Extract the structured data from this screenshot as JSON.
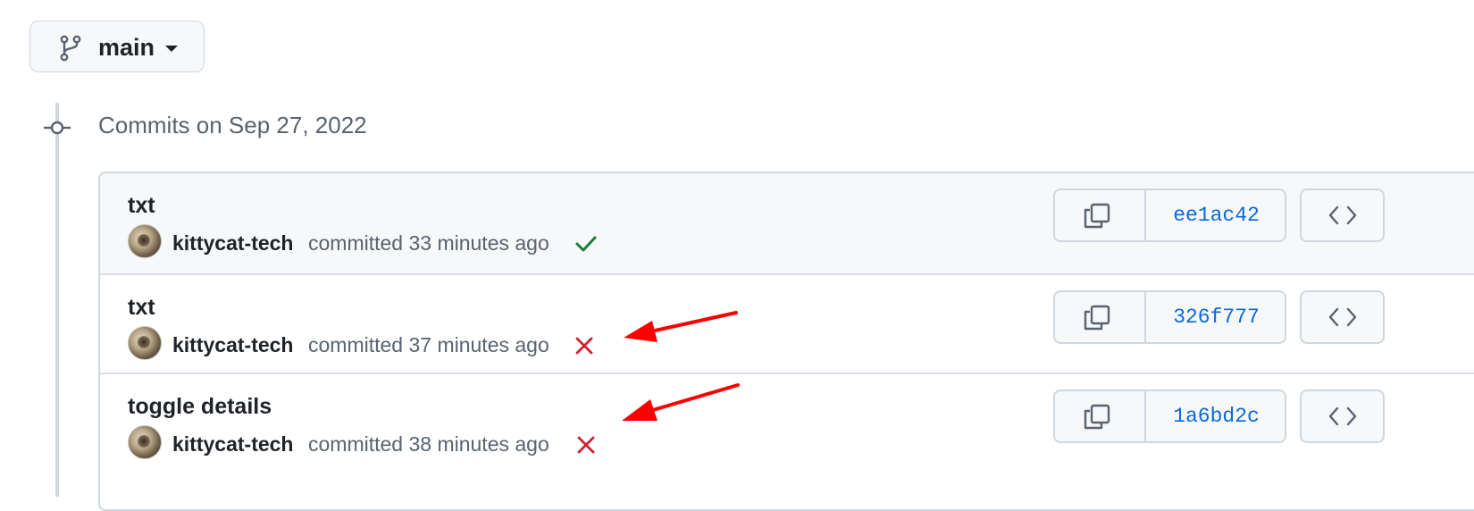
{
  "branch": {
    "name": "main",
    "icon": "git-branch-icon"
  },
  "date_heading": "Commits on Sep 27, 2022",
  "commits": [
    {
      "title": "txt",
      "author": "kittycat-tech",
      "meta": "committed 33 minutes ago",
      "status": "success",
      "sha": "ee1ac42"
    },
    {
      "title": "txt",
      "author": "kittycat-tech",
      "meta": "committed 37 minutes ago",
      "status": "failure",
      "sha": "326f777"
    },
    {
      "title": "toggle details",
      "author": "kittycat-tech",
      "meta": "committed 38 minutes ago",
      "status": "failure",
      "sha": "1a6bd2c"
    }
  ],
  "colors": {
    "success": "#1a7f37",
    "failure": "#cf222e",
    "link": "#0969da",
    "annotation": "#ff0000"
  }
}
